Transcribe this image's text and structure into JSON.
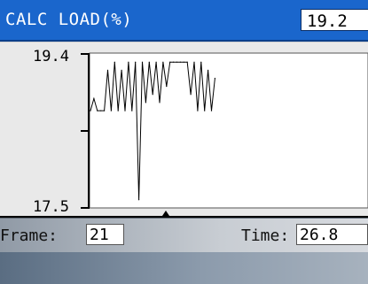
{
  "header": {
    "title": "CALC LOAD(%)",
    "current_value": "19.2"
  },
  "graph": {
    "y_max_label": "19.4",
    "y_min_label": "17.5",
    "line_color": "#000000",
    "background": "#ffffff"
  },
  "chart_data": {
    "type": "line",
    "title": "",
    "xlabel": "",
    "ylabel": "",
    "ylim": [
      17.5,
      19.4
    ],
    "series": [
      {
        "values": [
          18.7,
          18.85,
          18.7,
          18.7,
          18.7,
          19.2,
          18.7,
          19.3,
          18.7,
          19.2,
          18.7,
          19.3,
          18.7,
          19.3,
          17.6,
          19.3,
          18.8,
          19.3,
          18.9,
          19.3,
          18.8,
          19.3,
          19.0,
          19.3,
          19.3,
          19.3,
          19.3,
          19.3,
          19.3,
          18.9,
          19.3,
          18.7,
          19.3,
          18.7,
          19.2,
          18.7,
          19.1
        ]
      }
    ]
  },
  "status": {
    "frame_label": "Frame:",
    "frame_value": "21",
    "time_label": "Time:",
    "time_value": "26.8"
  }
}
